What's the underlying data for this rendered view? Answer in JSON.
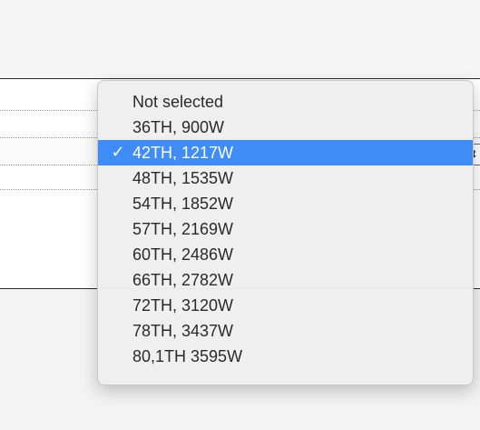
{
  "dropdown": {
    "items": [
      {
        "label": "Not selected",
        "selected": false
      },
      {
        "label": "36TH, 900W",
        "selected": false
      },
      {
        "label": "42TH, 1217W",
        "selected": true
      },
      {
        "label": "48TH, 1535W",
        "selected": false
      },
      {
        "label": "54TH, 1852W",
        "selected": false
      },
      {
        "label": "57TH, 2169W",
        "selected": false
      },
      {
        "label": "60TH, 2486W",
        "selected": false
      },
      {
        "label": "66TH, 2782W",
        "selected": false
      },
      {
        "label": "72TH, 3120W",
        "selected": false
      },
      {
        "label": "78TH, 3437W",
        "selected": false
      },
      {
        "label": "80,1TH 3595W",
        "selected": false
      }
    ],
    "checkmark_glyph": "✓",
    "stepper_glyph": "⬍",
    "highlight_color": "#3f8cf7",
    "icons": {
      "checkmark": "checkmark-icon",
      "stepper": "up-down-arrows-icon"
    }
  }
}
